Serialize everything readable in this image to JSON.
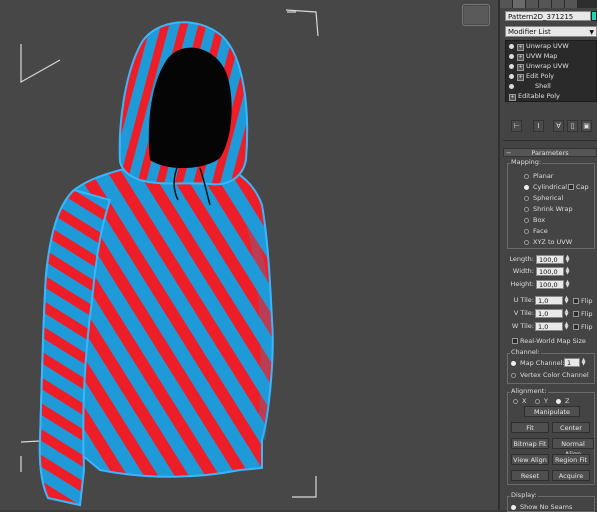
{
  "viewport": {
    "colors": {
      "stripe_red": "#ee1e28",
      "stripe_blue": "#1f9ad8",
      "background": "#474747",
      "outline": "#3ab6ff"
    }
  },
  "panel": {
    "object_name": "Pattern2D_371215",
    "object_color": "#14d6b4",
    "modifier_list_label": "Modifier List",
    "stack": [
      {
        "label": "Unwrap UVW",
        "selected": false
      },
      {
        "label": "UVW Map",
        "selected": false
      },
      {
        "label": "Unwrap UVW",
        "selected": false
      },
      {
        "label": "Edit Poly",
        "selected": false
      },
      {
        "label": "Shell",
        "selected": false
      },
      {
        "label": "Editable Poly",
        "selected": false
      }
    ],
    "stack_buttons": [
      "pin-stack",
      "show-end-result",
      "make-unique",
      "remove-modifier",
      "configure-sets"
    ],
    "parameters": {
      "title": "Parameters",
      "mapping_label": "Mapping:",
      "mapping_options": [
        "Planar",
        "Cylindrical",
        "Spherical",
        "Shrink Wrap",
        "Box",
        "Face",
        "XYZ to UVW"
      ],
      "mapping_selected": "Cylindrical",
      "cap_label": "Cap",
      "length_label": "Length:",
      "length_value": "100,0",
      "width_label": "Width:",
      "width_value": "100,0",
      "height_label": "Height:",
      "height_value": "100,0",
      "utile_label": "U Tile:",
      "utile_value": "1,0",
      "vtile_label": "V Tile:",
      "vtile_value": "1,0",
      "wtile_label": "W Tile:",
      "wtile_value": "1,0",
      "flip_label": "Flip",
      "real_world_label": "Real-World Map Size",
      "channel_label": "Channel:",
      "map_channel_label": "Map Channel:",
      "map_channel_value": "1",
      "vertex_color_label": "Vertex Color Channel",
      "alignment_label": "Alignment:",
      "axis_x": "X",
      "axis_y": "Y",
      "axis_z": "Z",
      "axis_selected": "Z",
      "manipulate_label": "Manipulate",
      "fit_label": "Fit",
      "center_label": "Center",
      "bitmap_fit_label": "Bitmap Fit",
      "normal_align_label": "Normal Align",
      "view_align_label": "View Align",
      "region_fit_label": "Region Fit",
      "reset_label": "Reset",
      "acquire_label": "Acquire",
      "display_label": "Display:",
      "show_no_seams_label": "Show No Seams"
    }
  }
}
